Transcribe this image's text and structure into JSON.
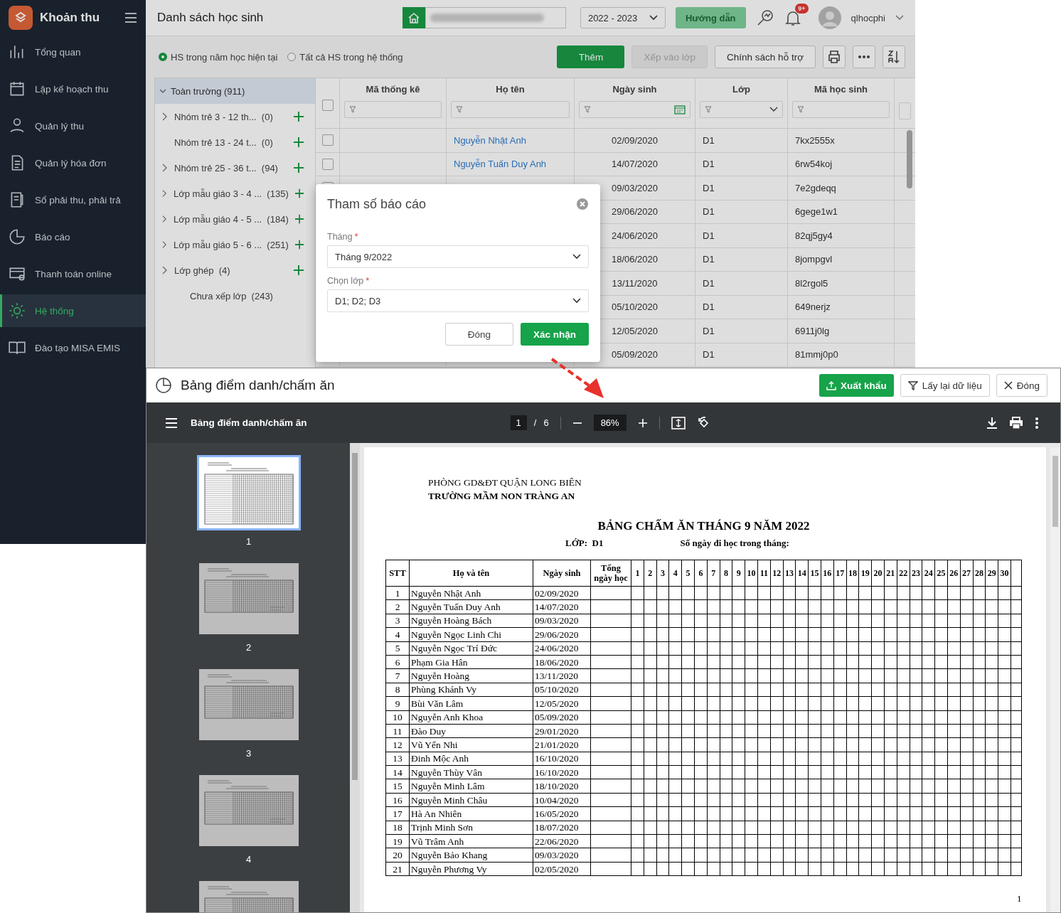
{
  "app": {
    "logo_title": "Khoản thu",
    "page_title": "Danh sách học sinh",
    "school_year": "2022 - 2023",
    "guide_button": "Hướng dẫn",
    "notification_badge": "9+",
    "user": "qlhocphi"
  },
  "sidebar": {
    "items": [
      {
        "label": "Tổng quan",
        "selected": false
      },
      {
        "label": "Lập kế hoạch thu",
        "selected": false
      },
      {
        "label": "Quản lý thu",
        "selected": false
      },
      {
        "label": "Quản lý hóa đơn",
        "selected": false
      },
      {
        "label": "Sổ phải thu, phải trả",
        "selected": false
      },
      {
        "label": "Báo cáo",
        "selected": false
      },
      {
        "label": "Thanh toán online",
        "selected": false
      },
      {
        "label": "Hệ thống",
        "selected": true
      },
      {
        "label": "Đào tạo MISA EMIS",
        "selected": false
      }
    ]
  },
  "filters": [
    {
      "label": "HS trong năm học hiện tại",
      "selected": true
    },
    {
      "label": "Tất cả HS trong hệ thống",
      "selected": false
    }
  ],
  "toolbar": {
    "buttons": [
      {
        "label": "Thêm",
        "kind": "primary"
      },
      {
        "label": "Xếp vào lớp",
        "kind": "disabled"
      },
      {
        "label": "Chính sách hỗ trợ",
        "kind": "default"
      }
    ]
  },
  "tree": {
    "root": {
      "label": "Toàn trường (911)",
      "expanded": true,
      "selected": true,
      "children": [
        {
          "label": "Nhóm trẻ 3 - 12 th...",
          "count": "(0)",
          "has_children": true,
          "can_add": true
        },
        {
          "label": "Nhóm trẻ 13 - 24 t...",
          "count": "(0)",
          "has_children": false,
          "can_add": true
        },
        {
          "label": "Nhóm trẻ 25 - 36 t...",
          "count": "(94)",
          "has_children": true,
          "can_add": true
        },
        {
          "label": "Lớp mẫu giáo 3 - 4 ...",
          "count": "(135)",
          "has_children": true,
          "can_add": true
        },
        {
          "label": "Lớp mẫu giáo 4 - 5 ...",
          "count": "(184)",
          "has_children": true,
          "can_add": true
        },
        {
          "label": "Lớp mẫu giáo 5 - 6 ...",
          "count": "(251)",
          "has_children": true,
          "can_add": true
        },
        {
          "label": "Lớp ghép",
          "count": "(4)",
          "has_children": true,
          "can_add": true
        },
        {
          "label": "Chưa xếp lớp",
          "count": "(243)",
          "has_children": false,
          "can_add": false
        }
      ]
    }
  },
  "grid": {
    "select_all_checked": false,
    "columns": [
      {
        "label": "Mã thống kê",
        "kind": "text"
      },
      {
        "label": "Họ tên",
        "kind": "text"
      },
      {
        "label": "Ngày sinh",
        "kind": "date"
      },
      {
        "label": "Lớp",
        "kind": "select"
      },
      {
        "label": "Mã học sinh",
        "kind": "text"
      }
    ],
    "rows": [
      {
        "checked": false,
        "name": "Nguyễn Nhật Anh",
        "dob": "02/09/2020",
        "class": "D1",
        "code": "7kx2555x"
      },
      {
        "checked": false,
        "name": "Nguyễn Tuấn Duy Anh",
        "dob": "14/07/2020",
        "class": "D1",
        "code": "6rw54koj"
      },
      {
        "checked": false,
        "dob": "09/03/2020",
        "class": "D1",
        "code": "7e2gdeqq"
      },
      {
        "dob": "29/06/2020",
        "class": "D1",
        "code": "6gege1w1"
      },
      {
        "dob": "24/06/2020",
        "class": "D1",
        "code": "82qj5gy4"
      },
      {
        "dob": "18/06/2020",
        "class": "D1",
        "code": "8jompgvl"
      },
      {
        "dob": "13/11/2020",
        "class": "D1",
        "code": "8l2rgol5"
      },
      {
        "dob": "05/10/2020",
        "class": "D1",
        "code": "649nerjz"
      },
      {
        "dob": "12/05/2020",
        "class": "D1",
        "code": "6911j0lg"
      },
      {
        "dob": "05/09/2020",
        "class": "D1",
        "code": "81mmj0p0"
      }
    ]
  },
  "dialog": {
    "title": "Tham số báo cáo",
    "fields": [
      {
        "label": "Tháng",
        "required_mark": "*",
        "value": "Tháng 9/2022"
      },
      {
        "label": "Chọn lớp",
        "required_mark": "*",
        "value": "D1; D2; D3"
      }
    ],
    "buttons": [
      {
        "label": "Đóng",
        "kind": "default"
      },
      {
        "label": "Xác nhận",
        "kind": "primary"
      }
    ]
  },
  "report_window": {
    "title": "Bảng điểm danh/chấm ăn",
    "buttons": [
      {
        "label": "Xuất khẩu",
        "kind": "export"
      },
      {
        "label": "Lấy lại dữ liệu",
        "kind": "filter"
      },
      {
        "label": "Đóng",
        "kind": "close"
      }
    ],
    "viewer": {
      "doc_title": "Bảng điểm danh/chấm ăn",
      "page": "1",
      "separator": "/",
      "page_count": "6",
      "zoom": "86%"
    },
    "thumbnails": [
      {
        "label": "1",
        "selected": true
      },
      {
        "label": "2",
        "selected": false
      },
      {
        "label": "3",
        "selected": false
      },
      {
        "label": "4",
        "selected": false
      },
      {
        "selected": false
      }
    ],
    "document": {
      "agency": "PHÒNG GD&ĐT QUẬN LONG BIÊN",
      "school": "TRƯỜNG MẦM NON TRÀNG AN",
      "title": "BẢNG CHẤM ĂN THÁNG 9 NĂM 2022",
      "class_label": "LỚP:  D1",
      "days_label": "Số ngày đi học trong tháng:",
      "columns": [
        "STT",
        "Họ và tên",
        "Ngày sinh",
        "Tổng ngày học"
      ],
      "days": [
        "1",
        "2",
        "3",
        "4",
        "5",
        "6",
        "7",
        "8",
        "9",
        "10",
        "11",
        "12",
        "13",
        "14",
        "15",
        "16",
        "17",
        "18",
        "19",
        "20",
        "21",
        "22",
        "23",
        "24",
        "25",
        "26",
        "27",
        "28",
        "29",
        "30"
      ],
      "rows": [
        [
          "1",
          "Nguyễn Nhật Anh",
          "02/09/2020"
        ],
        [
          "2",
          "Nguyễn Tuấn Duy Anh",
          "14/07/2020"
        ],
        [
          "3",
          "Nguyễn Hoàng Bách",
          "09/03/2020"
        ],
        [
          "4",
          "Nguyễn Ngọc Linh Chi",
          "29/06/2020"
        ],
        [
          "5",
          "Nguyễn Ngọc Trí Đức",
          "24/06/2020"
        ],
        [
          "6",
          "Phạm Gia Hân",
          "18/06/2020"
        ],
        [
          "7",
          "Nguyễn Hoàng",
          "13/11/2020"
        ],
        [
          "8",
          "Phùng Khánh Vy",
          "05/10/2020"
        ],
        [
          "9",
          "Bùi Văn Lâm",
          "12/05/2020"
        ],
        [
          "10",
          "Nguyễn Anh Khoa",
          "05/09/2020"
        ],
        [
          "11",
          "Đào Duy",
          "29/01/2020"
        ],
        [
          "12",
          "Vũ Yến Nhi",
          "21/01/2020"
        ],
        [
          "13",
          "Đinh Mộc Anh",
          "16/10/2020"
        ],
        [
          "14",
          "Nguyễn Thùy Vân",
          "16/10/2020"
        ],
        [
          "15",
          "Nguyễn Minh Lâm",
          "18/10/2020"
        ],
        [
          "16",
          "Nguyễn Minh Châu",
          "10/04/2020"
        ],
        [
          "17",
          "Hà An Nhiên",
          "16/05/2020"
        ],
        [
          "18",
          "Trịnh Minh Sơn",
          "18/07/2020"
        ],
        [
          "19",
          "Vũ Trâm Anh",
          "22/06/2020"
        ],
        [
          "20",
          "Nguyễn Bảo Khang",
          "09/03/2020"
        ],
        [
          "21",
          "Nguyễn Phương Vy",
          "02/05/2020"
        ]
      ],
      "page_number": "1"
    }
  }
}
